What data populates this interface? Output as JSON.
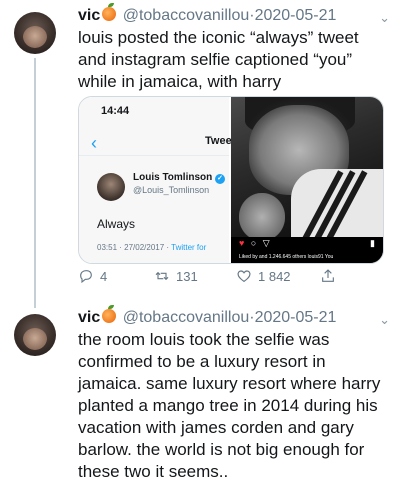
{
  "tweets": [
    {
      "name": "vic",
      "handle": "@tobaccovanillou",
      "dot": "·",
      "date": "2020-05-21",
      "text": "louis posted the iconic “always” tweet and instagram selfie captioned “you” while in jamaica, with harry",
      "replies": "4",
      "retweets": "131",
      "likes": "1 842"
    },
    {
      "name": "vic",
      "handle": "@tobaccovanillou",
      "dot": "·",
      "date": "2020-05-21",
      "text": "the room louis took the selfie was confirmed to be a luxury resort in jamaica. same luxury resort where harry planted a mango tree in 2014 during his vacation with james corden and gary barlow. the world is not big enough for these two it seems.."
    }
  ],
  "embedded_tweet": {
    "time": "14:44",
    "title": "Twee",
    "author_name": "Louis Tomlinson",
    "author_handle": "@Louis_Tomlinson",
    "text": "Always",
    "date": "03:51 · 27/02/2017 ·",
    "source": "Twitter for"
  },
  "instagram": {
    "likes_text": "Liked by",
    "likes_count": "and 1.246.645 others",
    "caption_user": "louis91 You"
  },
  "icons": [
    "peach-emoji",
    "chevron-down-icon",
    "reply-icon",
    "retweet-icon",
    "like-icon",
    "share-icon"
  ],
  "colors": {
    "accent": "#1da1f2",
    "muted": "#657786",
    "thread": "#c4cfd6"
  }
}
